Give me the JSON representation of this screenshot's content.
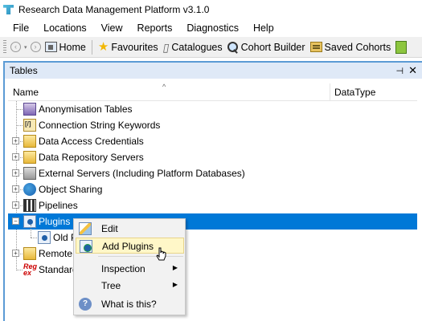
{
  "window": {
    "title": "Research Data Management Platform v3.1.0"
  },
  "menu": {
    "items": [
      "File",
      "Locations",
      "View",
      "Reports",
      "Diagnostics",
      "Help"
    ]
  },
  "toolbar": {
    "back_icon": "back-arrow-icon",
    "forward_icon": "forward-arrow-icon",
    "buttons": [
      {
        "label": "Home",
        "icon": "home-icon"
      },
      {
        "label": "Favourites",
        "icon": "star-icon"
      },
      {
        "label": "Catalogues",
        "icon": "catalogue-icon"
      },
      {
        "label": "Cohort Builder",
        "icon": "magnifier-icon"
      },
      {
        "label": "Saved Cohorts",
        "icon": "saved-cohorts-icon"
      }
    ]
  },
  "panel": {
    "title": "Tables",
    "pin_glyph": "📌",
    "close_glyph": "✕"
  },
  "columns": {
    "name": "Name",
    "datatype": "DataType"
  },
  "tree": {
    "nodes": [
      {
        "label": "Anonymisation Tables",
        "icon": "anonymisation-icon",
        "expandable": false
      },
      {
        "label": "Connection String Keywords",
        "icon": "connection-keywords-icon",
        "expandable": false
      },
      {
        "label": "Data Access Credentials",
        "icon": "folder-key-icon",
        "expandable": true,
        "expander": "+"
      },
      {
        "label": "Data Repository Servers",
        "icon": "folder-icon",
        "expandable": true,
        "expander": "+"
      },
      {
        "label": "External Servers (Including Platform Databases)",
        "icon": "server-icon",
        "expandable": true,
        "expander": "+"
      },
      {
        "label": "Object Sharing",
        "icon": "sharing-icon",
        "expandable": true,
        "expander": "+"
      },
      {
        "label": "Pipelines",
        "icon": "pipeline-icon",
        "expandable": true,
        "expander": "+"
      },
      {
        "label": "Plugins",
        "icon": "plugin-icon",
        "expandable": true,
        "expander": "−",
        "selected": true
      },
      {
        "label": "Old P",
        "icon": "plugin-icon",
        "expandable": false,
        "child": true
      },
      {
        "label": "Remote I",
        "icon": "remote-icon",
        "expandable": true,
        "expander": "+"
      },
      {
        "label": "Standard",
        "icon": "regex-icon",
        "expandable": false
      }
    ]
  },
  "context_menu": {
    "items": [
      {
        "label": "Edit",
        "icon": "edit-icon"
      },
      {
        "label": "Add Plugins",
        "icon": "add-plugin-icon",
        "hover": true
      },
      {
        "label": "Inspection",
        "submenu": true
      },
      {
        "label": "Tree",
        "submenu": true
      },
      {
        "label": "What is this?",
        "icon": "help-icon"
      }
    ],
    "submenu_glyph": "▶"
  }
}
